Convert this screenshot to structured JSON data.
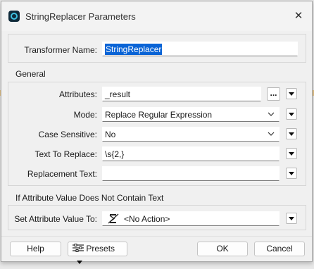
{
  "window": {
    "title": "StringReplacer Parameters",
    "close_glyph": "✕"
  },
  "transformer": {
    "label": "Transformer Name:",
    "value": "StringReplacer"
  },
  "general": {
    "heading": "General",
    "attributes": {
      "label": "Attributes:",
      "value": "_result",
      "browse_label": "..."
    },
    "mode": {
      "label": "Mode:",
      "value": "Replace Regular Expression"
    },
    "case_sensitive": {
      "label": "Case Sensitive:",
      "value": "No"
    },
    "text_to_replace": {
      "label": "Text To Replace:",
      "value": "\\s{2,}"
    },
    "replacement_text": {
      "label": "Replacement Text:",
      "value": ""
    }
  },
  "no_text": {
    "heading": "If Attribute Value Does Not Contain Text",
    "set_value": {
      "label": "Set Attribute Value To:",
      "value": "<No Action>"
    }
  },
  "buttons": {
    "help": "Help",
    "presets": "Presets",
    "ok": "OK",
    "cancel": "Cancel"
  },
  "icons": {
    "app": "fme-logo-icon",
    "no_action": "null-value-icon",
    "presets": "presets-menu-icon",
    "dropdown": "chevron-down-icon"
  },
  "colors": {
    "selection": "#0a64d6",
    "dialog_bg": "#f0f0f0"
  }
}
